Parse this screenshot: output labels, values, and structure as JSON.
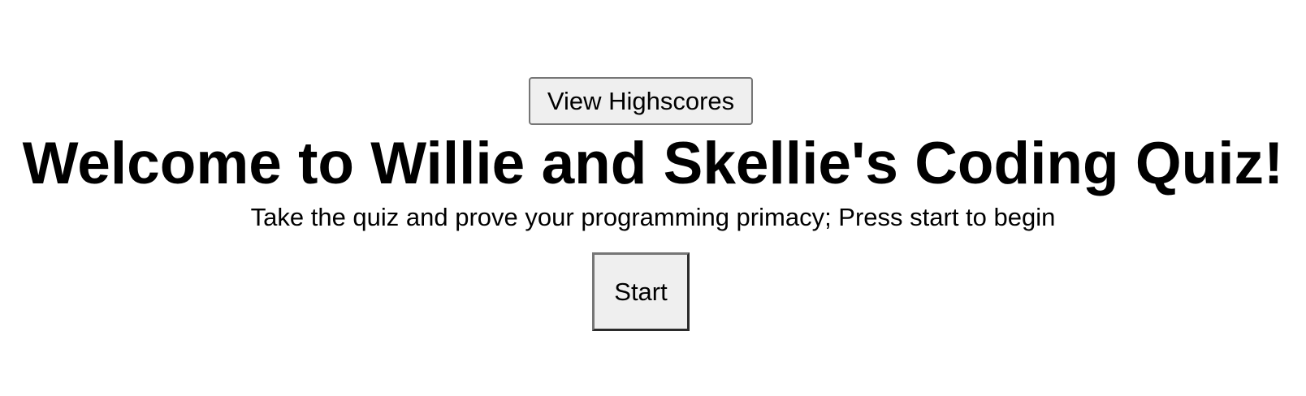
{
  "header": {
    "view_highscores_label": "View Highscores"
  },
  "main": {
    "title": "Welcome to Willie and Skellie's Coding Quiz!",
    "subtitle": "Take the quiz and prove your programming primacy; Press start to begin",
    "start_label": "Start"
  },
  "colors": {
    "background": "#ffffff",
    "text": "#000000",
    "button_background": "#efefef",
    "button_border": "#767676"
  }
}
